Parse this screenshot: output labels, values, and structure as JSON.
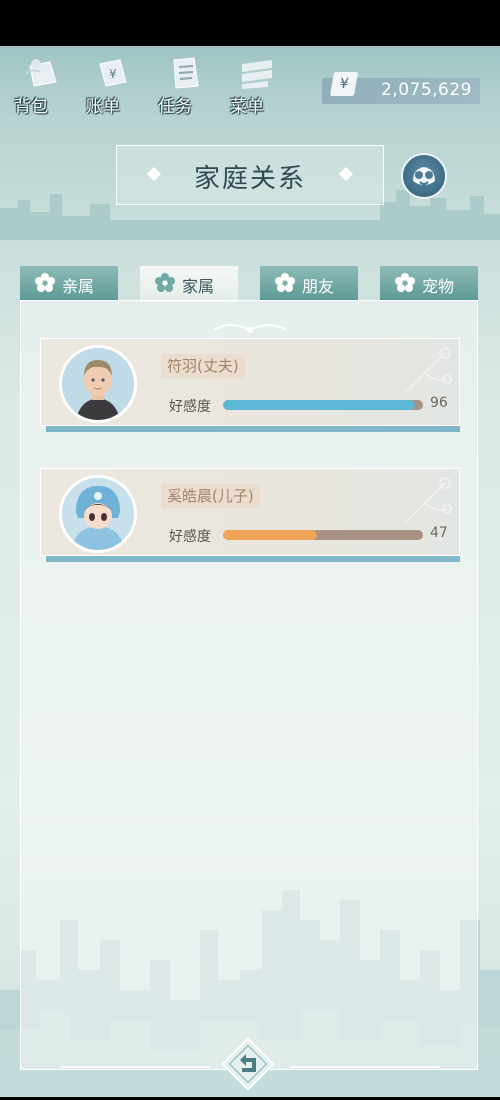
{
  "toolbar": {
    "items": [
      {
        "label": "背包",
        "icon": "bag-icon"
      },
      {
        "label": "账单",
        "icon": "bill-icon"
      },
      {
        "label": "任务",
        "icon": "task-icon"
      },
      {
        "label": "菜单",
        "icon": "menu-icon"
      }
    ]
  },
  "wallet": {
    "currency_symbol": "¥",
    "amount": "2,075,629"
  },
  "page": {
    "title": "家庭关系"
  },
  "tabs": [
    {
      "label": "亲属",
      "active": false
    },
    {
      "label": "家属",
      "active": true
    },
    {
      "label": "朋友",
      "active": false
    },
    {
      "label": "宠物",
      "active": false
    }
  ],
  "members": [
    {
      "name": "符羽(丈夫)",
      "affection_label": "好感度",
      "affection": 96,
      "affection_max": 100,
      "bar_color": "#5cb8d4",
      "avatar": "man-avatar"
    },
    {
      "name": "奚皓晨(儿子)",
      "affection_label": "好感度",
      "affection": 47,
      "affection_max": 100,
      "bar_color": "#f0a45a",
      "avatar": "child-avatar"
    }
  ],
  "colors": {
    "tab_inactive": "#6fa8a4",
    "tab_active": "#f2f6f4",
    "name_tag_bg": "#eaddcf",
    "card_shadow": "#7fb6c8"
  }
}
